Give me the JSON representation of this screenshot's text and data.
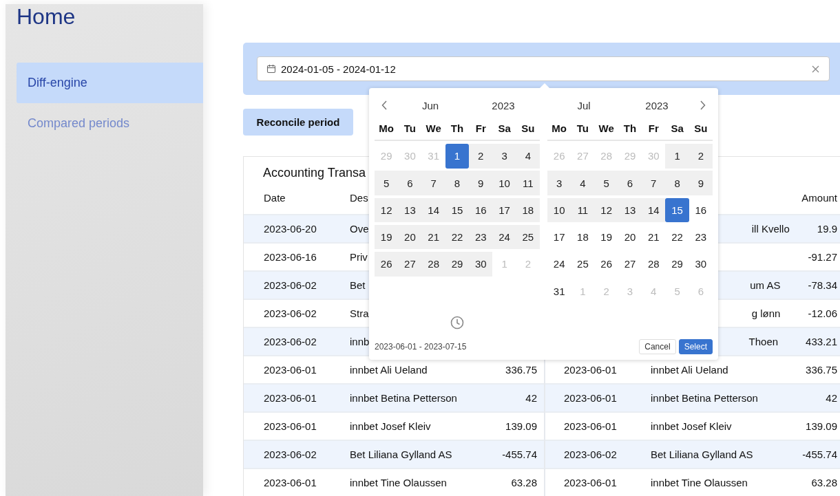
{
  "sidebar": {
    "title": "Home",
    "items": [
      {
        "label": "Diff-engine",
        "selected": true
      },
      {
        "label": "Compared periods",
        "selected": false
      }
    ]
  },
  "date_filter": {
    "value": "2024-01-05 - 2024-01-12"
  },
  "reconcile_button": {
    "label": "Reconcile period"
  },
  "panel": {
    "title": "Accounting Transa"
  },
  "tables": [
    {
      "columns": [
        {
          "kind": "date",
          "label": "Date"
        },
        {
          "kind": "description",
          "label": "Des"
        }
      ],
      "rows": [
        {
          "date": "2023-06-20",
          "description": "Ove"
        },
        {
          "date": "2023-06-16",
          "description": "Priv"
        },
        {
          "date": "2023-06-02",
          "description": "Bet"
        },
        {
          "date": "2023-06-02",
          "description": "Stra"
        },
        {
          "date": "2023-06-02",
          "description": "innb"
        },
        {
          "date": "2023-06-01",
          "description": "innbet Ali Ueland",
          "amount": "336.75"
        },
        {
          "date": "2023-06-01",
          "description": "innbet Betina Petterson",
          "amount": "42"
        },
        {
          "date": "2023-06-01",
          "description": "innbet Josef Kleiv",
          "amount": "139.09"
        },
        {
          "date": "2023-06-02",
          "description": "Bet Liliana Gylland AS",
          "amount": "-455.74"
        },
        {
          "date": "2023-06-01",
          "description": "innbet Tine Olaussen",
          "amount": "63.28"
        }
      ]
    },
    {
      "columns": [
        {
          "kind": "amount",
          "label": "Amount"
        }
      ],
      "rows": [
        {
          "description_end": "ill Kvello",
          "amount": "19.9"
        },
        {
          "amount": "-91.27"
        },
        {
          "description_end": "um AS",
          "amount": "-78.34"
        },
        {
          "description_end": "g lønn",
          "amount": "-12.06"
        },
        {
          "description_end": "Thoen",
          "amount": "433.21"
        },
        {
          "date": "2023-06-01",
          "description": "innbet Ali Ueland",
          "amount": "336.75"
        },
        {
          "date": "2023-06-01",
          "description": "innbet Betina Petterson",
          "amount": "42"
        },
        {
          "date": "2023-06-01",
          "description": "innbet Josef Kleiv",
          "amount": "139.09"
        },
        {
          "date": "2023-06-02",
          "description": "Bet Liliana Gylland AS",
          "amount": "-455.74"
        },
        {
          "date": "2023-06-01",
          "description": "innbet Tine Olaussen",
          "amount": "63.28"
        }
      ]
    }
  ],
  "date_picker": {
    "months": [
      {
        "month": "Jun",
        "year": "2023",
        "weekdays": [
          "Mo",
          "Tu",
          "We",
          "Th",
          "Fr",
          "Sa",
          "Su"
        ],
        "days": [
          {
            "label": "29",
            "kind": "outside"
          },
          {
            "label": "30",
            "kind": "outside"
          },
          {
            "label": "31",
            "kind": "outside"
          },
          {
            "label": "1",
            "kind": "selected"
          },
          {
            "label": "2",
            "kind": "in_range"
          },
          {
            "label": "3",
            "kind": "in_range"
          },
          {
            "label": "4",
            "kind": "in_range"
          },
          {
            "label": "5",
            "kind": "in_range"
          },
          {
            "label": "6",
            "kind": "in_range"
          },
          {
            "label": "7",
            "kind": "in_range"
          },
          {
            "label": "8",
            "kind": "in_range"
          },
          {
            "label": "9",
            "kind": "in_range"
          },
          {
            "label": "10",
            "kind": "in_range"
          },
          {
            "label": "11",
            "kind": "in_range"
          },
          {
            "label": "12",
            "kind": "in_range"
          },
          {
            "label": "13",
            "kind": "in_range"
          },
          {
            "label": "14",
            "kind": "in_range"
          },
          {
            "label": "15",
            "kind": "in_range"
          },
          {
            "label": "16",
            "kind": "in_range"
          },
          {
            "label": "17",
            "kind": "in_range"
          },
          {
            "label": "18",
            "kind": "in_range"
          },
          {
            "label": "19",
            "kind": "in_range"
          },
          {
            "label": "20",
            "kind": "in_range"
          },
          {
            "label": "21",
            "kind": "in_range"
          },
          {
            "label": "22",
            "kind": "in_range"
          },
          {
            "label": "23",
            "kind": "in_range"
          },
          {
            "label": "24",
            "kind": "in_range"
          },
          {
            "label": "25",
            "kind": "in_range"
          },
          {
            "label": "26",
            "kind": "in_range"
          },
          {
            "label": "27",
            "kind": "in_range"
          },
          {
            "label": "28",
            "kind": "in_range"
          },
          {
            "label": "29",
            "kind": "in_range"
          },
          {
            "label": "30",
            "kind": "in_range"
          },
          {
            "label": "1",
            "kind": "outside"
          },
          {
            "label": "2",
            "kind": "outside"
          }
        ]
      },
      {
        "month": "Jul",
        "year": "2023",
        "weekdays": [
          "Mo",
          "Tu",
          "We",
          "Th",
          "Fr",
          "Sa",
          "Su"
        ],
        "days": [
          {
            "label": "26",
            "kind": "outside"
          },
          {
            "label": "27",
            "kind": "outside"
          },
          {
            "label": "28",
            "kind": "outside"
          },
          {
            "label": "29",
            "kind": "outside"
          },
          {
            "label": "30",
            "kind": "outside"
          },
          {
            "label": "1",
            "kind": "in_range"
          },
          {
            "label": "2",
            "kind": "in_range"
          },
          {
            "label": "3",
            "kind": "in_range"
          },
          {
            "label": "4",
            "kind": "in_range"
          },
          {
            "label": "5",
            "kind": "in_range"
          },
          {
            "label": "6",
            "kind": "in_range"
          },
          {
            "label": "7",
            "kind": "in_range"
          },
          {
            "label": "8",
            "kind": "in_range"
          },
          {
            "label": "9",
            "kind": "in_range"
          },
          {
            "label": "10",
            "kind": "in_range"
          },
          {
            "label": "11",
            "kind": "in_range"
          },
          {
            "label": "12",
            "kind": "in_range"
          },
          {
            "label": "13",
            "kind": "in_range"
          },
          {
            "label": "14",
            "kind": "in_range"
          },
          {
            "label": "15",
            "kind": "selected"
          },
          {
            "label": "16",
            "kind": "plain"
          },
          {
            "label": "17",
            "kind": "plain"
          },
          {
            "label": "18",
            "kind": "plain"
          },
          {
            "label": "19",
            "kind": "plain"
          },
          {
            "label": "20",
            "kind": "plain"
          },
          {
            "label": "21",
            "kind": "plain"
          },
          {
            "label": "22",
            "kind": "plain"
          },
          {
            "label": "23",
            "kind": "plain"
          },
          {
            "label": "24",
            "kind": "plain"
          },
          {
            "label": "25",
            "kind": "plain"
          },
          {
            "label": "26",
            "kind": "plain"
          },
          {
            "label": "27",
            "kind": "plain"
          },
          {
            "label": "28",
            "kind": "plain"
          },
          {
            "label": "29",
            "kind": "plain"
          },
          {
            "label": "30",
            "kind": "plain"
          },
          {
            "label": "31",
            "kind": "plain"
          },
          {
            "label": "1",
            "kind": "outside"
          },
          {
            "label": "2",
            "kind": "outside"
          },
          {
            "label": "3",
            "kind": "outside"
          },
          {
            "label": "4",
            "kind": "outside"
          },
          {
            "label": "5",
            "kind": "outside"
          },
          {
            "label": "6",
            "kind": "outside"
          }
        ]
      }
    ],
    "range_text": "2023-06-01 - 2023-07-15",
    "buttons": [
      {
        "kind": "cancel",
        "label": "Cancel"
      },
      {
        "kind": "select",
        "label": "Select"
      }
    ]
  }
}
